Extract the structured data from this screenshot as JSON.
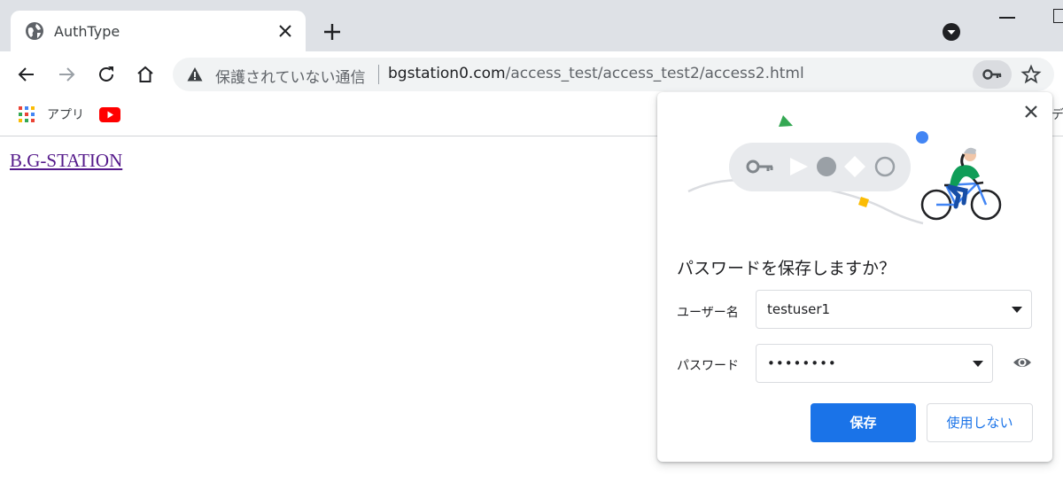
{
  "tab": {
    "title": "AuthType"
  },
  "omnibox": {
    "security_text": "保護されていない通信",
    "url_host": "bgstation0.com",
    "url_path": "/access_test/access_test2/access2.html"
  },
  "bookmarks": {
    "apps_label": "アプリ",
    "overflow_label": "デ"
  },
  "page": {
    "link_text": "B.G-STATION"
  },
  "password_bubble": {
    "heading": "パスワードを保存しますか？",
    "username_label": "ユーザー名",
    "username_value": "testuser1",
    "password_label": "パスワード",
    "password_value": "••••••••",
    "save_label": "保存",
    "never_label": "使用しない"
  },
  "colors": {
    "accent": "#1a73e8",
    "tabstrip": "#dee1e6",
    "link_visited": "#551a8b",
    "youtube_red": "#ff0000"
  }
}
